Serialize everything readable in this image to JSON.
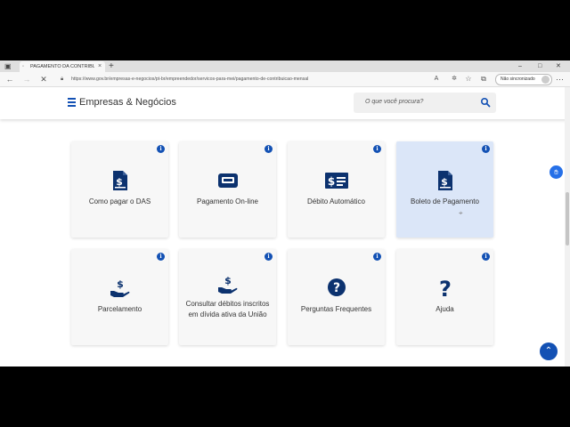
{
  "browser": {
    "tab_title": "PAGAMENTO DA CONTRIBUIÇÃO",
    "tab_close": "×",
    "new_tab": "+",
    "url": "https://www.gov.br/empresas-e-negocios/pt-br/empreendedor/servicos-para-mei/pagamento-de-contribuicao-mensal",
    "profile_label": "Não sincronizado",
    "window_minimize": "–",
    "window_maximize": "□",
    "window_close": "✕"
  },
  "header": {
    "title": "Empresas & Negócios",
    "search_placeholder": "O que você procura?"
  },
  "cards": [
    {
      "label": "Como pagar o DAS",
      "icon": "document-dollar-icon",
      "info": "i"
    },
    {
      "label": "Pagamento On-line",
      "icon": "card-reader-icon",
      "info": "i"
    },
    {
      "label": "Débito Automático",
      "icon": "check-dollar-icon",
      "info": "i"
    },
    {
      "label": "Boleto de Pagamento",
      "icon": "document-dollar-icon",
      "info": "i"
    },
    {
      "label": "Parcelamento",
      "icon": "hand-dollar-icon",
      "info": "i"
    },
    {
      "label": "Consultar débitos inscritos em dívida ativa da União",
      "icon": "hand-dollar-icon",
      "info": "i"
    },
    {
      "label": "Perguntas Frequentes",
      "icon": "question-circle-icon",
      "info": "i"
    },
    {
      "label": "Ajuda",
      "icon": "question-mark-icon",
      "info": "i"
    }
  ],
  "colors": {
    "brand_blue": "#1351b4",
    "icon_navy": "#0c326f",
    "card_bg": "#f7f7f7",
    "card_hover_bg": "#dbe6f8"
  }
}
